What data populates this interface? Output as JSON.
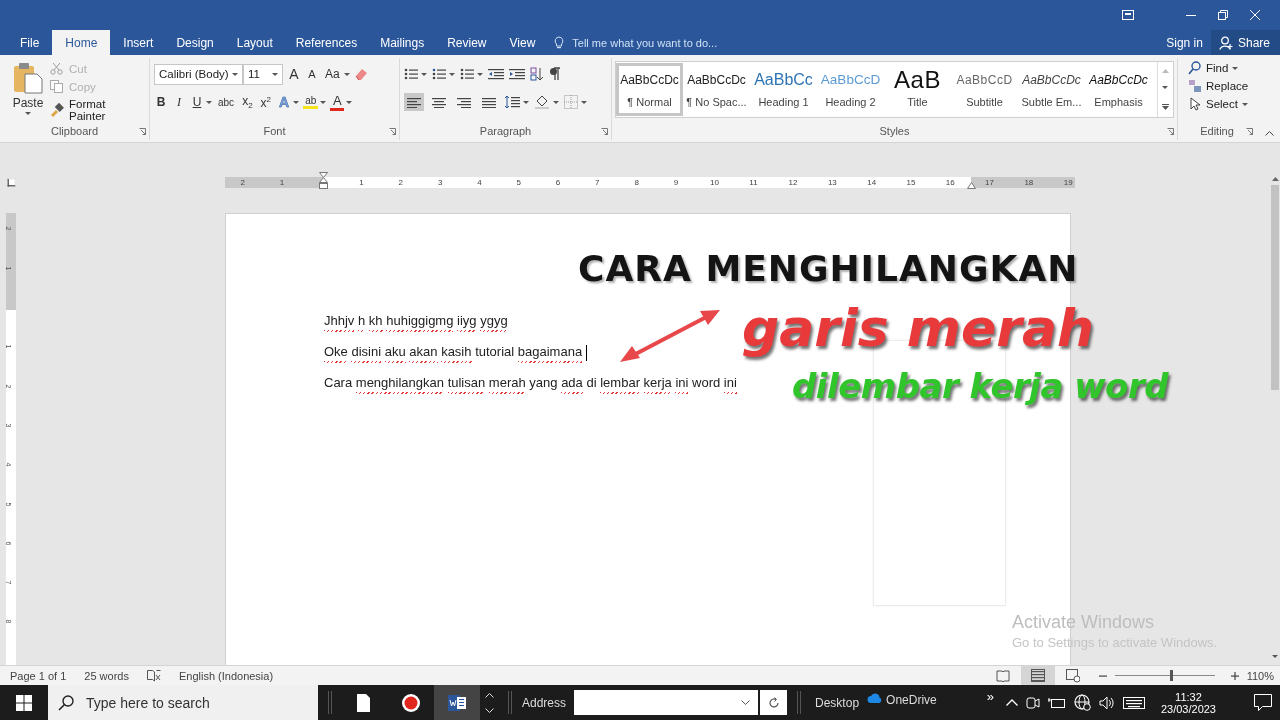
{
  "ribbon_tabs": [
    {
      "label": "File",
      "selected": false
    },
    {
      "label": "Home",
      "selected": true
    },
    {
      "label": "Insert",
      "selected": false
    },
    {
      "label": "Design",
      "selected": false
    },
    {
      "label": "Layout",
      "selected": false
    },
    {
      "label": "References",
      "selected": false
    },
    {
      "label": "Mailings",
      "selected": false
    },
    {
      "label": "Review",
      "selected": false
    },
    {
      "label": "View",
      "selected": false
    }
  ],
  "tell_me": {
    "placeholder": "Tell me what you want to do..."
  },
  "account": {
    "sign_in": "Sign in",
    "share": "Share"
  },
  "clipboard": {
    "label": "Clipboard",
    "paste": "Paste",
    "items": [
      {
        "label": "Cut",
        "disabled": true
      },
      {
        "label": "Copy",
        "disabled": true
      },
      {
        "label": "Format Painter",
        "disabled": false
      }
    ]
  },
  "font": {
    "label": "Font",
    "font_name": "Calibri (Body)",
    "font_size": "11",
    "row1_buttons": [
      {
        "label": "A",
        "kind": "grow"
      },
      {
        "label": "A",
        "kind": "shrink"
      },
      {
        "label": "Aa",
        "kind": "case"
      }
    ],
    "row2_buttons": [
      {
        "label": "B",
        "kind": "bold"
      },
      {
        "label": "I",
        "kind": "italic"
      },
      {
        "label": "U",
        "kind": "underline"
      },
      {
        "label": "abc",
        "kind": "strike"
      },
      {
        "label": "x$_{2}$",
        "kind": "sub"
      },
      {
        "label": "x$^{2}$",
        "kind": "sup"
      },
      {
        "label": "A",
        "kind": "effects"
      },
      {
        "label": "ab",
        "kind": "highlight"
      },
      {
        "label": "A",
        "kind": "color"
      }
    ]
  },
  "paragraph": {
    "label": "Paragraph",
    "alignments": [
      {
        "kind": "left",
        "selected": true
      },
      {
        "kind": "center",
        "selected": false
      },
      {
        "kind": "right",
        "selected": false
      },
      {
        "kind": "justify",
        "selected": false
      }
    ]
  },
  "styles": {
    "label": "Styles",
    "items": [
      {
        "preview": "AaBbCcDc",
        "name": "¶ Normal",
        "kind": "normal",
        "selected": true
      },
      {
        "preview": "AaBbCcDc",
        "name": "¶ No Spac...",
        "kind": "normal",
        "selected": false
      },
      {
        "preview": "AaBbCc",
        "name": "Heading 1",
        "kind": "heading1",
        "selected": false
      },
      {
        "preview": "AaBbCcD",
        "name": "Heading 2",
        "kind": "heading2",
        "selected": false
      },
      {
        "preview": "AaB",
        "name": "Title",
        "kind": "title",
        "selected": false
      },
      {
        "preview": "AaBbCcD",
        "name": "Subtitle",
        "kind": "subtitle",
        "selected": false
      },
      {
        "preview": "AaBbCcDc",
        "name": "Subtle Em...",
        "kind": "subtle",
        "selected": false
      },
      {
        "preview": "AaBbCcDc",
        "name": "Emphasis",
        "kind": "emphasis",
        "selected": false
      }
    ]
  },
  "editing": {
    "label": "Editing",
    "items": [
      {
        "label": "Find",
        "kind": "find"
      },
      {
        "label": "Replace",
        "kind": "replace"
      },
      {
        "label": "Select",
        "kind": "select"
      }
    ]
  },
  "ruler": {
    "left_labels": [
      "2",
      "1"
    ],
    "right_labels": [
      "1",
      "2",
      "3",
      "4",
      "5",
      "6",
      "7",
      "8",
      "9",
      "10",
      "11",
      "12",
      "13",
      "14",
      "15",
      "16",
      "17",
      "18",
      "19"
    ]
  },
  "vertical_ruler": {
    "top_labels": [
      "2",
      "1"
    ],
    "labels": [
      "1",
      "2",
      "3",
      "4",
      "5",
      "6",
      "7",
      "8"
    ]
  },
  "document": {
    "paragraphs": [
      {
        "cursor": false,
        "words": [
          {
            "text": "Jhhjv",
            "misspelled": true
          },
          {
            "text": "h",
            "misspelled": true
          },
          {
            "text": "kh",
            "misspelled": true
          },
          {
            "text": "huhiggigmg",
            "misspelled": true
          },
          {
            "text": "iiyg",
            "misspelled": true
          },
          {
            "text": "ygyg",
            "misspelled": true
          }
        ]
      },
      {
        "cursor": true,
        "words": [
          {
            "text": "Oke",
            "misspelled": true
          },
          {
            "text": "disini",
            "misspelled": true
          },
          {
            "text": "aku",
            "misspelled": true
          },
          {
            "text": "akan",
            "misspelled": true
          },
          {
            "text": "kasih",
            "misspelled": true
          },
          {
            "text": "tutorial",
            "misspelled": false
          },
          {
            "text": "bagaimana",
            "misspelled": true
          }
        ]
      },
      {
        "cursor": false,
        "words": [
          {
            "text": "Cara",
            "misspelled": false
          },
          {
            "text": "menghilangkan",
            "misspelled": true
          },
          {
            "text": "tulisan",
            "misspelled": true
          },
          {
            "text": "merah",
            "misspelled": true
          },
          {
            "text": "yang",
            "misspelled": false
          },
          {
            "text": "ada",
            "misspelled": true
          },
          {
            "text": "di",
            "misspelled": false
          },
          {
            "text": "lembar",
            "misspelled": true
          },
          {
            "text": "kerja",
            "misspelled": true
          },
          {
            "text": "ini",
            "misspelled": true
          },
          {
            "text": "word",
            "misspelled": false
          },
          {
            "text": "ini",
            "misspelled": true
          }
        ]
      }
    ]
  },
  "overlay_caption": [
    {
      "text": "CARA MENGHILANGKAN",
      "color": "#141414"
    },
    {
      "text": "garis merah",
      "color": "#e8393b"
    },
    {
      "text": "dilembar kerja word",
      "color": "#2fc52b"
    }
  ],
  "activation_notice": {
    "title": "Activate Windows",
    "message": "Go to Settings to activate Windows."
  },
  "status_bar": {
    "page": "Page 1 of 1",
    "words": "25 words",
    "language": "English (Indonesia)",
    "view_buttons": [
      {
        "kind": "read",
        "selected": false
      },
      {
        "kind": "print",
        "selected": true
      },
      {
        "kind": "web",
        "selected": false
      }
    ],
    "zoom_slider": {
      "level": 0.56
    },
    "zoom": "110%"
  },
  "taskbar": {
    "search_placeholder": "Type here to search",
    "apps": [
      {
        "kind": "file",
        "selected": false
      },
      {
        "kind": "record",
        "selected": false
      },
      {
        "kind": "word",
        "selected": true
      }
    ],
    "address_label": "Address",
    "desktop": "Desktop",
    "onedrive": "OneDrive",
    "overflow": "»",
    "time": "11:32",
    "date": "23/03/2023"
  }
}
